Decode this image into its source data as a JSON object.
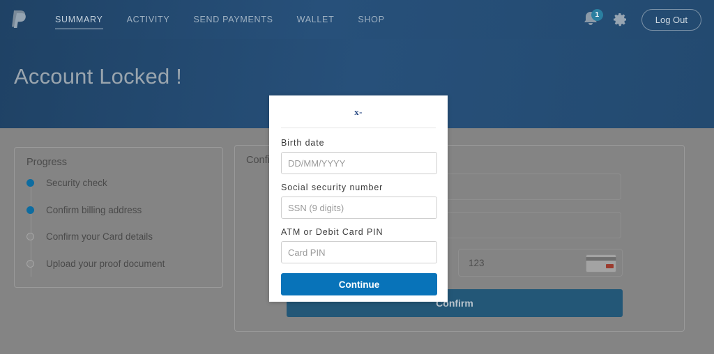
{
  "header": {
    "logo": "paypal-logo",
    "nav": [
      {
        "label": "SUMMARY",
        "active": true
      },
      {
        "label": "ACTIVITY",
        "active": false
      },
      {
        "label": "SEND PAYMENTS",
        "active": false
      },
      {
        "label": "WALLET",
        "active": false
      },
      {
        "label": "SHOP",
        "active": false
      }
    ],
    "notifications_count": "1",
    "logout_label": "Log Out",
    "bg_color": "#27507a"
  },
  "hero": {
    "title": "Account Locked !"
  },
  "progress": {
    "title": "Progress",
    "steps": [
      {
        "label": "Security check",
        "state": "done"
      },
      {
        "label": "Confirm billing address",
        "state": "done"
      },
      {
        "label": "Confirm your Card details",
        "state": "todo"
      },
      {
        "label": "Upload your proof document",
        "state": "todo"
      }
    ],
    "done_color": "#0d6ca0"
  },
  "form": {
    "heading": "Confirm",
    "field1_value": "",
    "field2_value": "",
    "cvv_value": "123",
    "confirm_label": "Confirm",
    "confirm_color": "#235777"
  },
  "modal": {
    "header_text": "x-",
    "fields": [
      {
        "label": "Birth date",
        "placeholder": "DD/MM/YYYY",
        "value": ""
      },
      {
        "label": "Social security number",
        "placeholder": "SSN (9 digits)",
        "value": ""
      },
      {
        "label": "ATM or Debit Card PIN",
        "placeholder": "Card PIN",
        "value": ""
      }
    ],
    "continue_label": "Continue",
    "continue_color": "#0873b9"
  }
}
